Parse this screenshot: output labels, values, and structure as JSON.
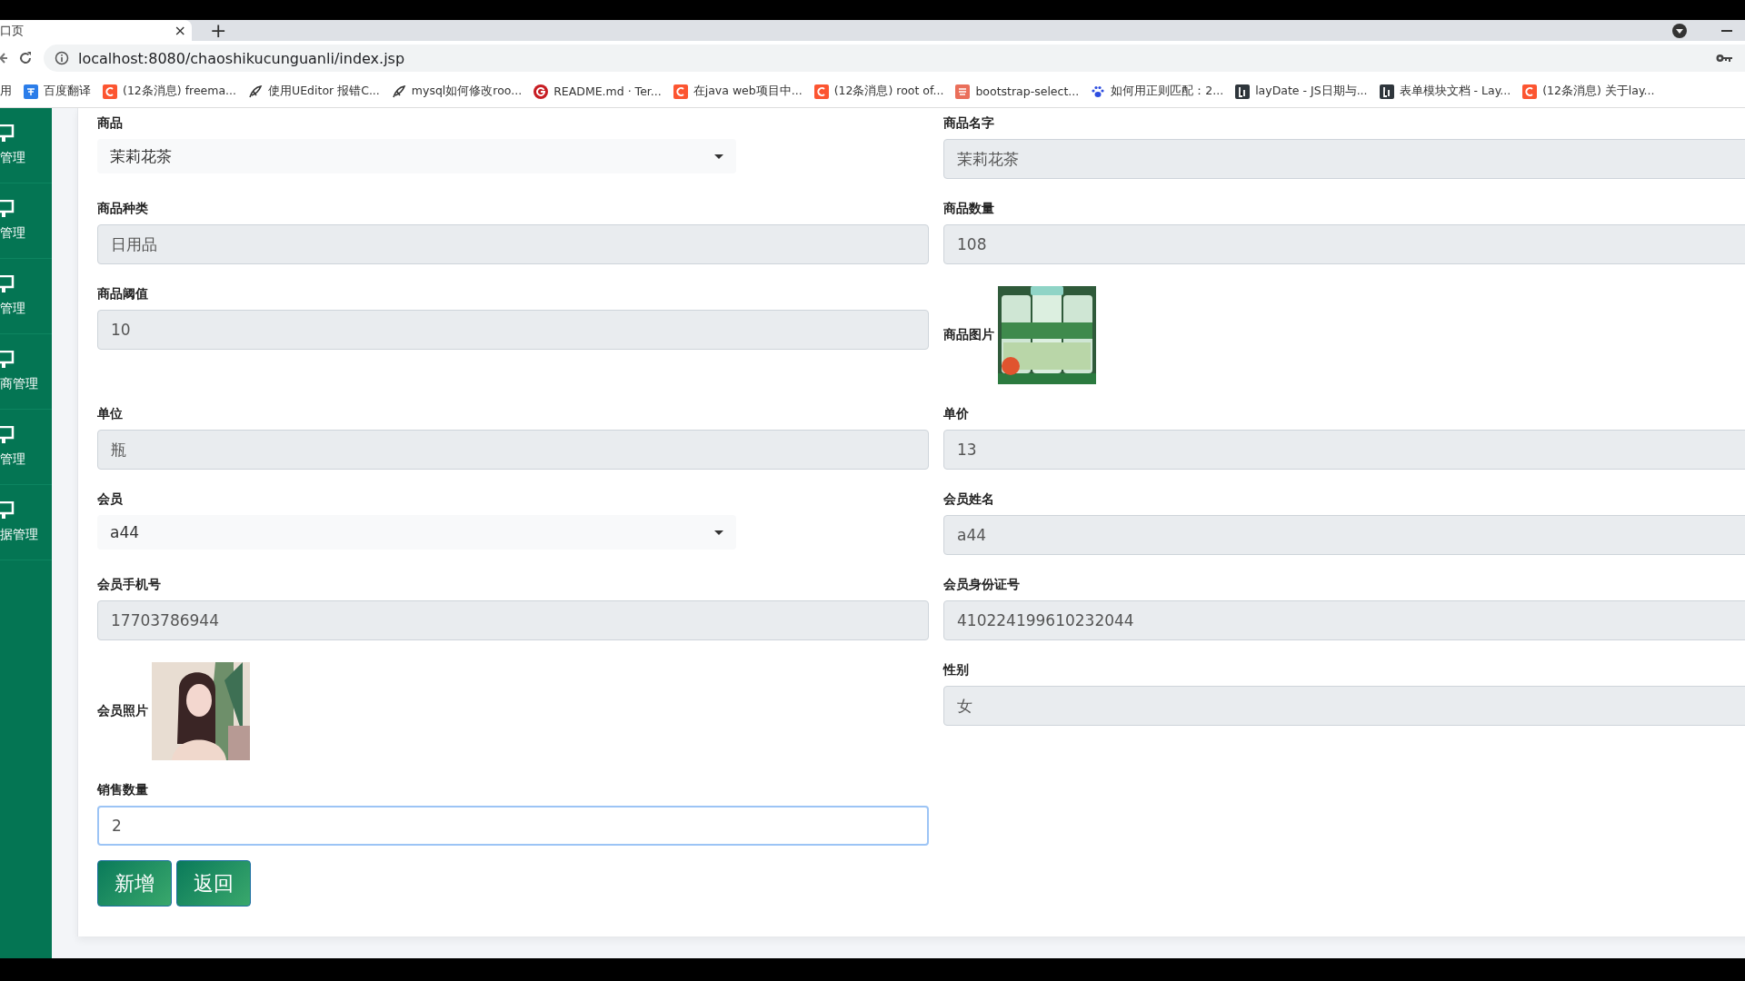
{
  "browser": {
    "tab": {
      "title": "口页",
      "close": "×"
    },
    "new_tab": "+",
    "address": "localhost:8080/chaoshikucunguanli/index.jsp",
    "bookmarks": [
      {
        "kind": "plain",
        "label": "用"
      },
      {
        "kind": "translate",
        "label": "百度翻译"
      },
      {
        "kind": "csdn",
        "label": "(12条消息) freema..."
      },
      {
        "kind": "feather",
        "label": "使用UEditor 报错C..."
      },
      {
        "kind": "feather",
        "label": "mysql如何修改roo..."
      },
      {
        "kind": "ring",
        "label": "README.md · Ter..."
      },
      {
        "kind": "csdn",
        "label": "在java web项目中..."
      },
      {
        "kind": "csdn",
        "label": "(12条消息) root of..."
      },
      {
        "kind": "jianshu",
        "label": "bootstrap-select..."
      },
      {
        "kind": "paw",
        "label": "如何用正则匹配：2..."
      },
      {
        "kind": "layui",
        "label": "layDate - JS日期与..."
      },
      {
        "kind": "layui",
        "label": "表单模块文档 - Lay..."
      },
      {
        "kind": "csdn",
        "label": "(12条消息) 关于lay..."
      }
    ]
  },
  "sidebar": {
    "items": [
      {
        "label": "管理"
      },
      {
        "label": "管理"
      },
      {
        "label": "管理"
      },
      {
        "label": "商管理"
      },
      {
        "label": "管理"
      },
      {
        "label": "据管理"
      }
    ]
  },
  "form": {
    "rows": [
      {
        "cells": [
          {
            "kind": "select",
            "label": "商品",
            "value": "茉莉花茶"
          },
          {
            "kind": "input",
            "label": "商品名字",
            "value": "茉莉花茶",
            "readonly": true
          }
        ]
      },
      {
        "cells": [
          {
            "kind": "input",
            "label": "商品种类",
            "value": "日用品",
            "readonly": true
          },
          {
            "kind": "input",
            "label": "商品数量",
            "value": "108",
            "readonly": true
          }
        ]
      },
      {
        "cells": [
          {
            "kind": "input",
            "label": "商品阈值",
            "value": "10",
            "readonly": true
          },
          {
            "label": "商品图片"
          }
        ]
      },
      {
        "cells": [
          {
            "kind": "input",
            "label": "单位",
            "value": "瓶",
            "readonly": true
          },
          {
            "kind": "input",
            "label": "单价",
            "value": "13",
            "readonly": true
          }
        ]
      },
      {
        "cells": [
          {
            "kind": "select",
            "label": "会员",
            "value": "a44"
          },
          {
            "kind": "input",
            "label": "会员姓名",
            "value": "a44",
            "readonly": true
          }
        ]
      },
      {
        "cells": [
          {
            "kind": "input",
            "label": "会员手机号",
            "value": "17703786944",
            "readonly": true
          },
          {
            "kind": "input",
            "label": "会员身份证号",
            "value": "410224199610232044",
            "readonly": true
          }
        ]
      },
      {
        "cells": [
          {
            "label": "会员照片"
          },
          {
            "kind": "input",
            "label": "性别",
            "value": "女",
            "readonly": true
          }
        ]
      },
      {
        "cells": [
          {
            "kind": "input",
            "label": "销售数量",
            "value": "2",
            "readonly": false
          }
        ]
      }
    ]
  },
  "buttons": [
    "新增",
    "返回"
  ]
}
